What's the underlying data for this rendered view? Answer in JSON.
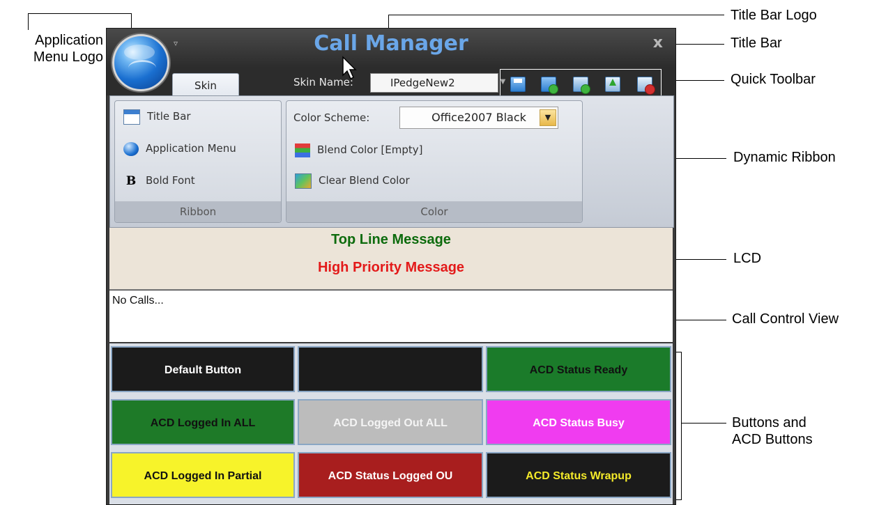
{
  "annotations": {
    "application_menu_logo": [
      "Application",
      "Menu Logo"
    ],
    "title_bar_logo": "Title Bar Logo",
    "title_bar": "Title Bar",
    "quick_toolbar": "Quick Toolbar",
    "dynamic_ribbon": "Dynamic Ribbon",
    "lcd": "LCD",
    "call_control_view": "Call Control View",
    "buttons": [
      "Buttons and",
      "ACD Buttons"
    ]
  },
  "window": {
    "title": "Call Manager",
    "close": "x"
  },
  "tabs": {
    "skin": "Skin"
  },
  "skin": {
    "label": "Skin Name:",
    "value": "IPedgeNew2"
  },
  "quick_toolbar": {
    "icons": [
      "save-icon",
      "save-new-icon",
      "new-window-icon",
      "export-icon",
      "delete-icon"
    ]
  },
  "ribbon": {
    "group_ribbon": {
      "label": "Ribbon",
      "items": [
        "Title Bar",
        "Application Menu",
        "Bold Font"
      ]
    },
    "group_color": {
      "label": "Color",
      "color_scheme_label": "Color Scheme:",
      "color_scheme_value": "Office2007 Black",
      "items": [
        "Blend Color [Empty]",
        "Clear Blend Color"
      ]
    }
  },
  "lcd": {
    "top_line": "Top Line Message",
    "high_priority": "High Priority Message",
    "colors": {
      "top": "#0d6b0d",
      "high": "#e31a1a"
    }
  },
  "call_control": {
    "status": "No Calls..."
  },
  "buttons": [
    {
      "label": "Default Button",
      "bg": "#1b1b1b",
      "fg": "#ffffff"
    },
    {
      "label": "",
      "bg": "#1b1b1b",
      "fg": "#ffffff"
    },
    {
      "label": "ACD Status Ready",
      "bg": "#1b7b2a",
      "fg": "#111111"
    },
    {
      "label": "ACD Logged In ALL",
      "bg": "#1e7a28",
      "fg": "#111111"
    },
    {
      "label": "ACD Logged Out ALL",
      "bg": "#bcbcbc",
      "fg": "#f4f4f4"
    },
    {
      "label": "ACD Status Busy",
      "bg": "#f03cf0",
      "fg": "#ffffff"
    },
    {
      "label": "ACD Logged In Partial",
      "bg": "#f7f32a",
      "fg": "#111111"
    },
    {
      "label": "ACD Status Logged OU",
      "bg": "#a81e1e",
      "fg": "#ffffff"
    },
    {
      "label": "ACD Status Wrapup",
      "bg": "#1b1b1b",
      "fg": "#f4ea2a"
    }
  ]
}
